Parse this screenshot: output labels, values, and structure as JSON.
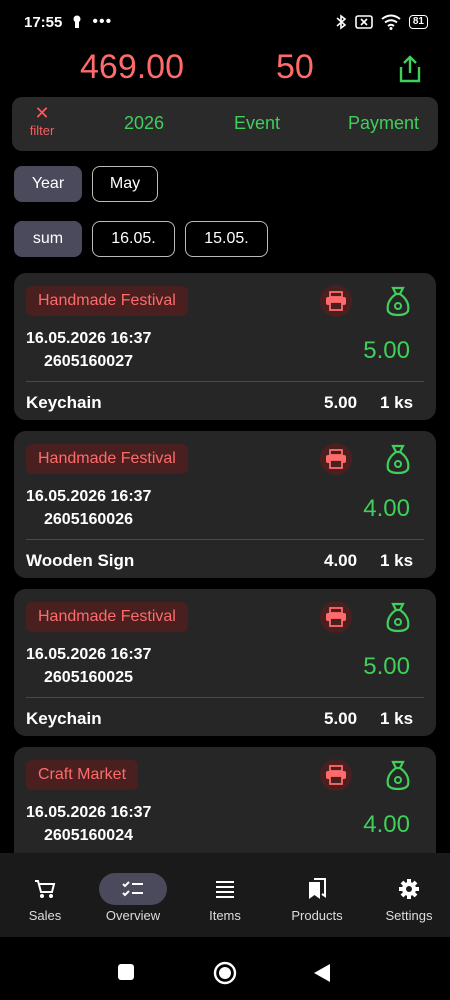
{
  "status": {
    "time": "17:55",
    "battery": "81"
  },
  "header": {
    "total_amount": "469.00",
    "total_count": "50"
  },
  "filter": {
    "clear_label": "filter",
    "clear_x": "✕",
    "year": "2026",
    "event": "Event",
    "payment": "Payment"
  },
  "chips_row1": [
    {
      "label": "Year",
      "active": true
    },
    {
      "label": "May",
      "active": false
    }
  ],
  "chips_row2": [
    {
      "label": "sum",
      "active": true
    },
    {
      "label": "16.05.",
      "active": false
    },
    {
      "label": "15.05.",
      "active": false
    }
  ],
  "transactions": [
    {
      "event": "Handmade Festival",
      "datetime": "16.05.2026 16:37",
      "number": "2605160027",
      "amount": "5.00",
      "item": "Keychain",
      "item_price": "5.00",
      "qty": "1 ks"
    },
    {
      "event": "Handmade Festival",
      "datetime": "16.05.2026 16:37",
      "number": "2605160026",
      "amount": "4.00",
      "item": "Wooden Sign",
      "item_price": "4.00",
      "qty": "1 ks"
    },
    {
      "event": "Handmade Festival",
      "datetime": "16.05.2026 16:37",
      "number": "2605160025",
      "amount": "5.00",
      "item": "Keychain",
      "item_price": "5.00",
      "qty": "1 ks"
    },
    {
      "event": "Craft Market",
      "datetime": "16.05.2026 16:37",
      "number": "2605160024",
      "amount": "4.00",
      "item": "",
      "item_price": "",
      "qty": ""
    }
  ],
  "nav": [
    {
      "label": "Sales",
      "icon": "cart-icon"
    },
    {
      "label": "Overview",
      "icon": "checklist-icon"
    },
    {
      "label": "Items",
      "icon": "list-icon"
    },
    {
      "label": "Products",
      "icon": "bookmarks-icon"
    },
    {
      "label": "Settings",
      "icon": "gear-icon"
    }
  ],
  "colors": {
    "accent_red": "#ff6b6b",
    "accent_green": "#3fcf5a",
    "card_bg": "#262626",
    "chip_active": "#4a4a5c"
  }
}
